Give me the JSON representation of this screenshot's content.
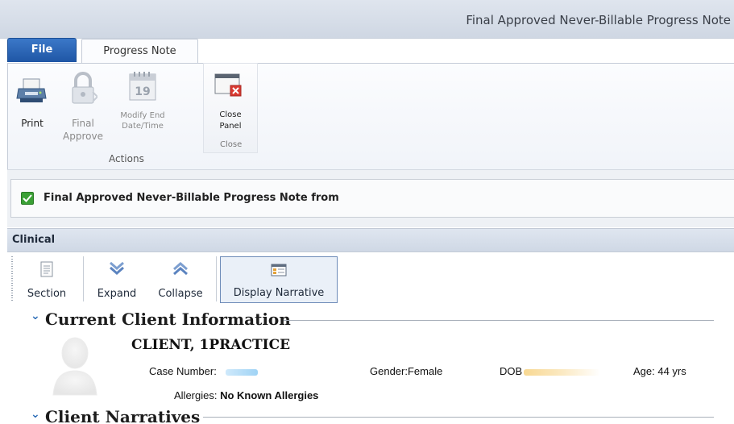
{
  "window": {
    "title": "Final Approved Never-Billable Progress Note"
  },
  "tabs": {
    "file": "File",
    "progress_note": "Progress Note"
  },
  "ribbon": {
    "print": "Print",
    "final_approve_1": "Final",
    "final_approve_2": "Approve",
    "modify_1": "Modify End",
    "modify_2": "Date/Time",
    "calendar_day": "19",
    "close_panel_1": "Close",
    "close_panel_2": "Panel",
    "group_actions": "Actions",
    "group_close": "Close"
  },
  "info_bar": {
    "text": "Final Approved Never-Billable Progress Note from",
    "checked": true
  },
  "clinical": {
    "label": "Clinical",
    "toolbar": {
      "section": "Section",
      "expand": "Expand",
      "collapse": "Collapse",
      "display_narrative": "Display Narrative"
    }
  },
  "sections": {
    "current_client": {
      "title": "Current Client Information",
      "client_name": "CLIENT, 1PRACTICE",
      "case_number_label": "Case Number:",
      "gender": "Gender:Female",
      "dob_label": "DOB",
      "age": "Age: 44 yrs",
      "allergies_label": "Allergies:",
      "allergies_value": "No Known Allergies"
    },
    "client_narratives": {
      "title": "Client Narratives"
    }
  },
  "colors": {
    "accent": "#1f56a5",
    "check_green": "#3aa035",
    "chevron": "#2f6fb8"
  }
}
